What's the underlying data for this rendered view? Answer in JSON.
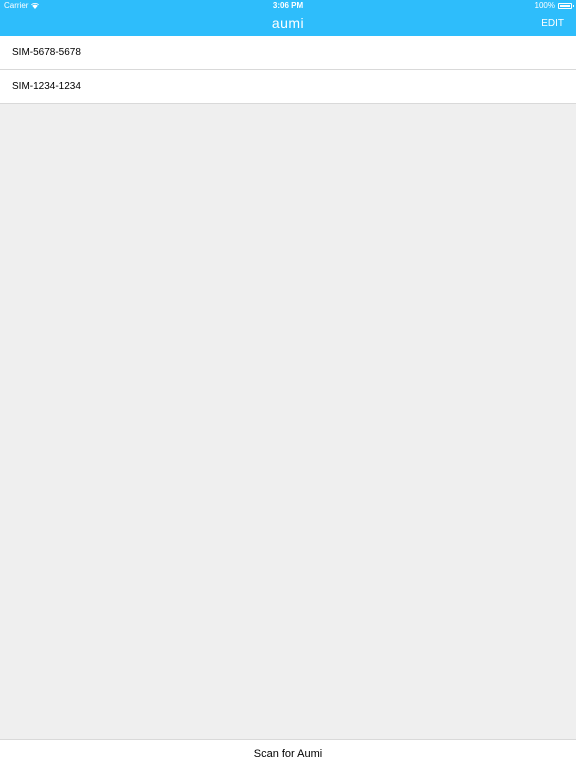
{
  "status_bar": {
    "carrier": "Carrier",
    "time": "3:06 PM",
    "battery": "100%"
  },
  "nav_bar": {
    "logo": "aumi",
    "edit_label": "EDIT"
  },
  "list": {
    "items": [
      {
        "label": "SIM-5678-5678"
      },
      {
        "label": "SIM-1234-1234"
      }
    ]
  },
  "bottom_bar": {
    "scan_label": "Scan for Aumi"
  },
  "colors": {
    "accent": "#2ebdfb",
    "background": "#efefef"
  }
}
